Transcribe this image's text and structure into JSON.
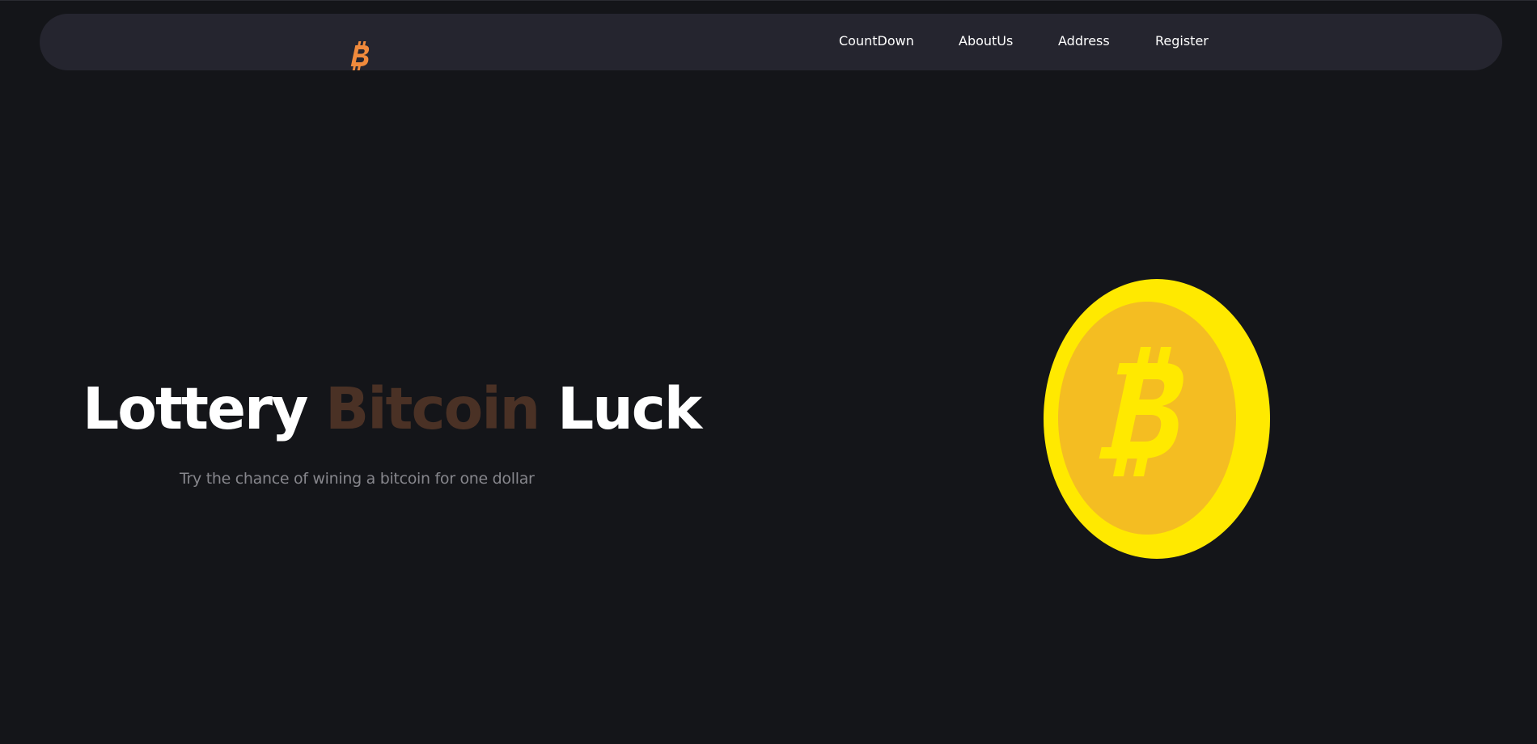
{
  "nav": {
    "logo_icon": "bitcoin-icon",
    "links": [
      {
        "label": "CountDown"
      },
      {
        "label": "AboutUs"
      },
      {
        "label": "Address"
      },
      {
        "label": "Register"
      }
    ]
  },
  "hero": {
    "title_part1": "Lottery ",
    "title_accent": "Bitcoin",
    "title_part2": " Luck",
    "subtitle": "Try the chance of wining a bitcoin for one dollar",
    "coin_icon": "bitcoin-coin-icon"
  },
  "colors": {
    "background": "#141519",
    "navbar": "#25252f",
    "logo": "#f08a3c",
    "accent_text": "#4a3125",
    "subtitle": "#86868c",
    "coin_rim": "#ffe900",
    "coin_face": "#f4bd22"
  }
}
